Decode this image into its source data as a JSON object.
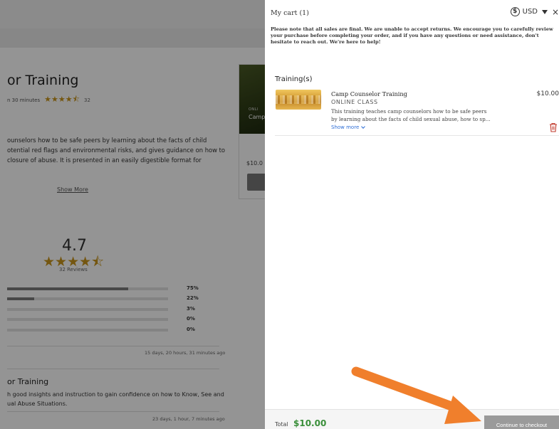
{
  "background": {
    "course_title": "or Training",
    "duration": "n  30 minutes",
    "rating_count_small": "32",
    "description_lines": [
      "ounselors how to be safe peers by learning about the facts of child",
      "otential red flags and environmental risks, and gives guidance on how to",
      "closure of abuse. It is presented in an easily digestible format for"
    ],
    "show_more": "Show More",
    "card": {
      "tag": "ONLI",
      "name": "Camp",
      "price": "$10.0"
    },
    "rating": {
      "average": "4.7",
      "reviews_label": "32 Reviews",
      "distribution": [
        {
          "pct_label": "75%",
          "fraction": 0.75
        },
        {
          "pct_label": "22%",
          "fraction": 0.17
        },
        {
          "pct_label": "3%",
          "fraction": 0.0
        },
        {
          "pct_label": "0%",
          "fraction": 0.0
        },
        {
          "pct_label": "0%",
          "fraction": 0.0
        }
      ]
    },
    "review1_time": "15 days, 20 hours, 31 minutes ago",
    "review2": {
      "title": "or Training",
      "text_lines": [
        "h good insights and instruction to gain confidence on how to Know, See and",
        "ual Abuse Situations."
      ],
      "time": "23 days, 1 hour, 7 minutes ago"
    }
  },
  "cart": {
    "title": "My cart (1)",
    "currency": "USD",
    "currency_symbol": "$",
    "close_glyph": "×",
    "notice": "Please note that all sales are final. We are unable to accept returns. We encourage you to carefully review your purchase before completing your order, and if you have any questions or need assistance, don't hesitate to reach out. We're here to help!",
    "section_title": "Training(s)",
    "item": {
      "name": "Camp Counselor Training",
      "type": "ONLINE CLASS",
      "desc_lines": [
        "This training teaches camp counselors how to be safe peers",
        "by learning about the facts of child sexual abuse, how to sp..."
      ],
      "show_more": "Show more",
      "price": "$10.00"
    },
    "total_label": "Total",
    "total_value": "$10.00",
    "checkout_label": "Continue to checkout"
  },
  "colors": {
    "accent_green": "#3a8f3a",
    "link_blue": "#2f6fd6",
    "trash_red": "#c0392b",
    "star_gold": "#c8951c",
    "arrow_orange": "#f07f2c"
  }
}
